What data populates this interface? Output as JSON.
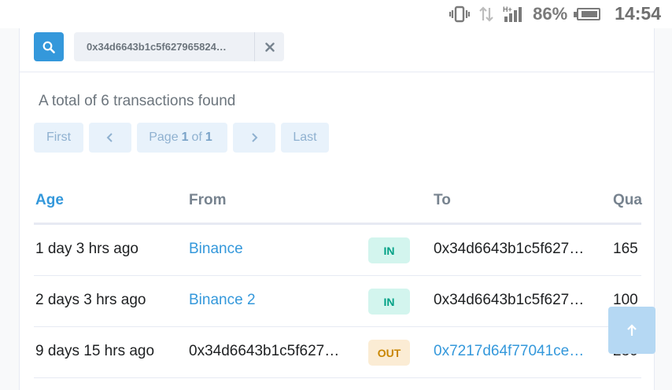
{
  "status_bar": {
    "battery_percent": "86%",
    "time": "14:54",
    "icons": [
      "vibrate-icon",
      "data-arrows-icon",
      "signal-icon",
      "battery-icon"
    ]
  },
  "search": {
    "value": "0x34d6643b1c5f627965824…"
  },
  "summary": {
    "text": "A total of 6 transactions found"
  },
  "pagination": {
    "first_label": "First",
    "page_label": "Page",
    "page_current": "1",
    "of_label": "of",
    "page_total": "1",
    "last_label": "Last"
  },
  "table": {
    "headers": {
      "age": "Age",
      "from": "From",
      "to": "To",
      "quantity": "Qua"
    },
    "rows": [
      {
        "age": "1 day 3 hrs ago",
        "from": "Binance",
        "direction": "IN",
        "to": "0x34d6643b1c5f627…",
        "quantity": "165"
      },
      {
        "age": "2 days 3 hrs ago",
        "from": "Binance 2",
        "direction": "IN",
        "to": "0x34d6643b1c5f627…",
        "quantity": "100"
      },
      {
        "age": "9 days 15 hrs ago",
        "from": "0x34d6643b1c5f627…",
        "direction": "OUT",
        "to": "0x7217d64f77041ce…",
        "quantity": "230"
      }
    ]
  },
  "colors": {
    "primary": "#3498db",
    "in_badge": "#00a186",
    "out_badge": "#c98600"
  }
}
